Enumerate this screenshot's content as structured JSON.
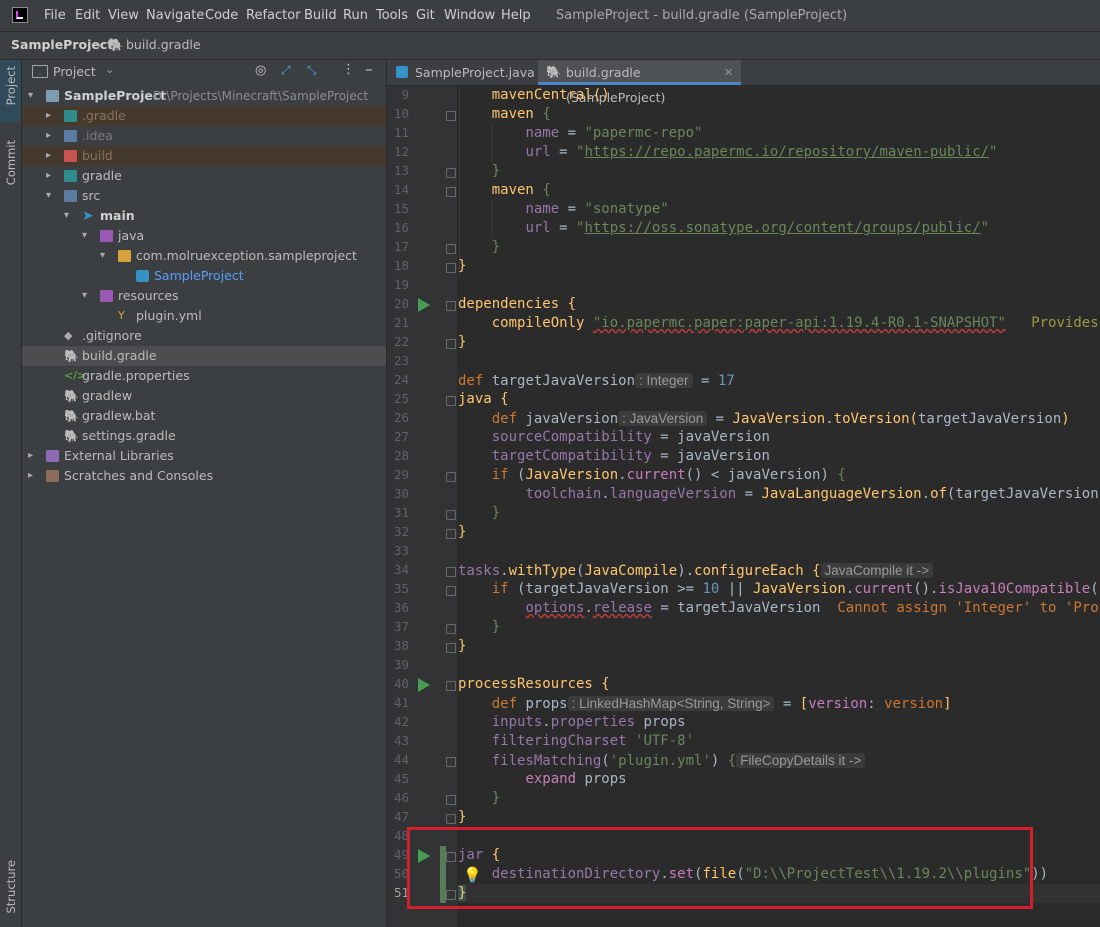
{
  "menubar": {
    "items": [
      "File",
      "Edit",
      "View",
      "Navigate",
      "Code",
      "Refactor",
      "Build",
      "Run",
      "Tools",
      "Git",
      "Window",
      "Help"
    ],
    "title": "SampleProject - build.gradle (SampleProject)"
  },
  "breadcrumb": {
    "project": "SampleProject",
    "file": "build.gradle"
  },
  "toolstrip": {
    "project": "Project",
    "commit": "Commit",
    "structure": "Structure"
  },
  "project_panel": {
    "title": "Project",
    "tree": [
      {
        "label": "SampleProject",
        "extra": "D:\\Projects\\Minecraft\\SampleProject",
        "bold": true,
        "expanded": true
      },
      {
        "label": ".gradle",
        "muted": true
      },
      {
        "label": ".idea",
        "muted": true
      },
      {
        "label": "build",
        "muted": true
      },
      {
        "label": "gradle"
      },
      {
        "label": "src",
        "expanded": true
      },
      {
        "label": "main",
        "bold": true,
        "expanded": true
      },
      {
        "label": "java",
        "expanded": true
      },
      {
        "label": "com.molruexception.sampleproject",
        "expanded": true
      },
      {
        "label": "SampleProject",
        "blue": true
      },
      {
        "label": "resources",
        "expanded": true
      },
      {
        "label": "plugin.yml"
      },
      {
        "label": ".gitignore"
      },
      {
        "label": "build.gradle",
        "selected": true
      },
      {
        "label": "gradle.properties"
      },
      {
        "label": "gradlew"
      },
      {
        "label": "gradlew.bat"
      },
      {
        "label": "settings.gradle"
      },
      {
        "label": "External Libraries"
      },
      {
        "label": "Scratches and Consoles"
      }
    ]
  },
  "editor": {
    "tabs": [
      {
        "label": "SampleProject.java",
        "active": false
      },
      {
        "label": "build.gradle (SampleProject)",
        "active": true
      }
    ],
    "line_numbers": [
      "9",
      "10",
      "11",
      "12",
      "13",
      "14",
      "15",
      "16",
      "17",
      "18",
      "19",
      "20",
      "21",
      "22",
      "23",
      "24",
      "25",
      "26",
      "27",
      "28",
      "29",
      "30",
      "31",
      "32",
      "33",
      "34",
      "35",
      "36",
      "37",
      "38",
      "39",
      "40",
      "41",
      "42",
      "43",
      "44",
      "45",
      "46",
      "47",
      "48",
      "49",
      "50",
      "51"
    ],
    "hints": {
      "integer": ": Integer",
      "javaversion": ": JavaVersion",
      "javacompile": "JavaCompile it ->",
      "linkedhashmap": ": LinkedHashMap<String, String>",
      "filecopy": "FileCopyDetails it ->"
    },
    "notes": {
      "provides": "Provides tra",
      "cannot_assign": "Cannot assign 'Integer' to 'Property"
    }
  }
}
